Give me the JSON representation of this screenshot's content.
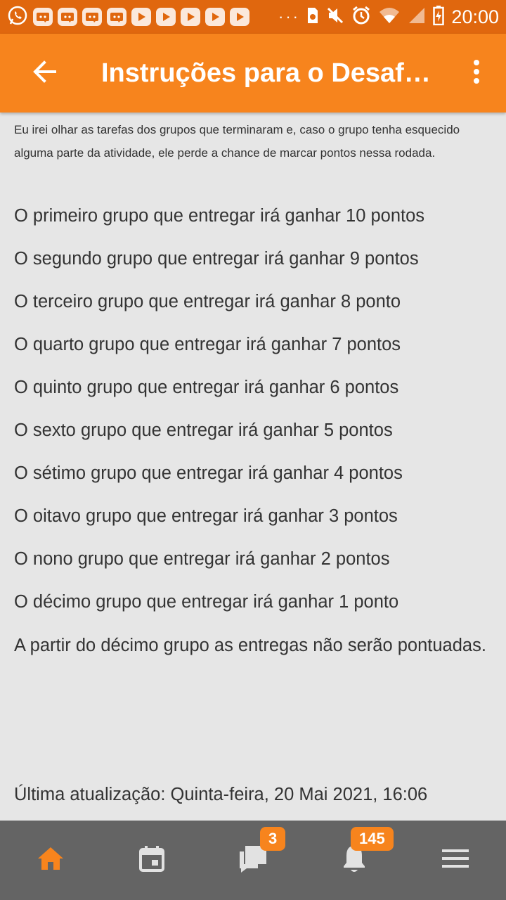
{
  "status_bar": {
    "time": "20:00",
    "overflow": "···",
    "notification_icons": [
      "whatsapp-icon",
      "discord-icon",
      "discord-icon",
      "discord-icon",
      "discord-icon",
      "youtube-icon",
      "youtube-icon",
      "youtube-icon",
      "youtube-icon",
      "youtube-icon"
    ],
    "system_icons": [
      "storage-icon",
      "mute-icon",
      "alarm-icon",
      "wifi-icon",
      "signal-icon",
      "battery-icon"
    ]
  },
  "app_bar": {
    "title": "Instruções para o Desafi…",
    "back_icon": "arrow-back-icon",
    "menu_icon": "more-vert-icon"
  },
  "content": {
    "intro": "Eu irei olhar as tarefas dos grupos que terminaram e, caso o grupo tenha esquecido alguma parte da atividade, ele perde a chance de marcar pontos nessa rodada.",
    "rules": [
      "O primeiro grupo que entregar irá ganhar 10 pontos",
      "O segundo grupo que entregar irá ganhar 9 pontos",
      "O terceiro grupo que entregar irá ganhar 8 ponto",
      "O quarto grupo que entregar irá ganhar 7 pontos",
      "O quinto grupo que entregar irá ganhar 6 pontos",
      "O sexto grupo que entregar irá ganhar 5 pontos",
      "O sétimo grupo que entregar irá ganhar 4 pontos",
      "O oitavo grupo que entregar irá ganhar 3 pontos",
      "O nono grupo que entregar irá ganhar 2 pontos",
      "O décimo grupo que entregar irá ganhar 1 ponto"
    ],
    "final_note": "A partir do décimo grupo as entregas não serão pontuadas.",
    "last_updated": "Última atualização: Quinta-feira, 20 Mai 2021, 16:06"
  },
  "bottom_nav": {
    "items": [
      {
        "icon": "home-icon",
        "active": true
      },
      {
        "icon": "calendar-icon"
      },
      {
        "icon": "messages-icon",
        "badge": "3"
      },
      {
        "icon": "notifications-icon",
        "badge": "145"
      },
      {
        "icon": "hamburger-menu-icon"
      }
    ]
  },
  "colors": {
    "status_bar": "#e0670e",
    "app_bar": "#f7841d",
    "background": "#e6e6e6",
    "bottom_nav": "#646464",
    "accent": "#f7841d"
  }
}
